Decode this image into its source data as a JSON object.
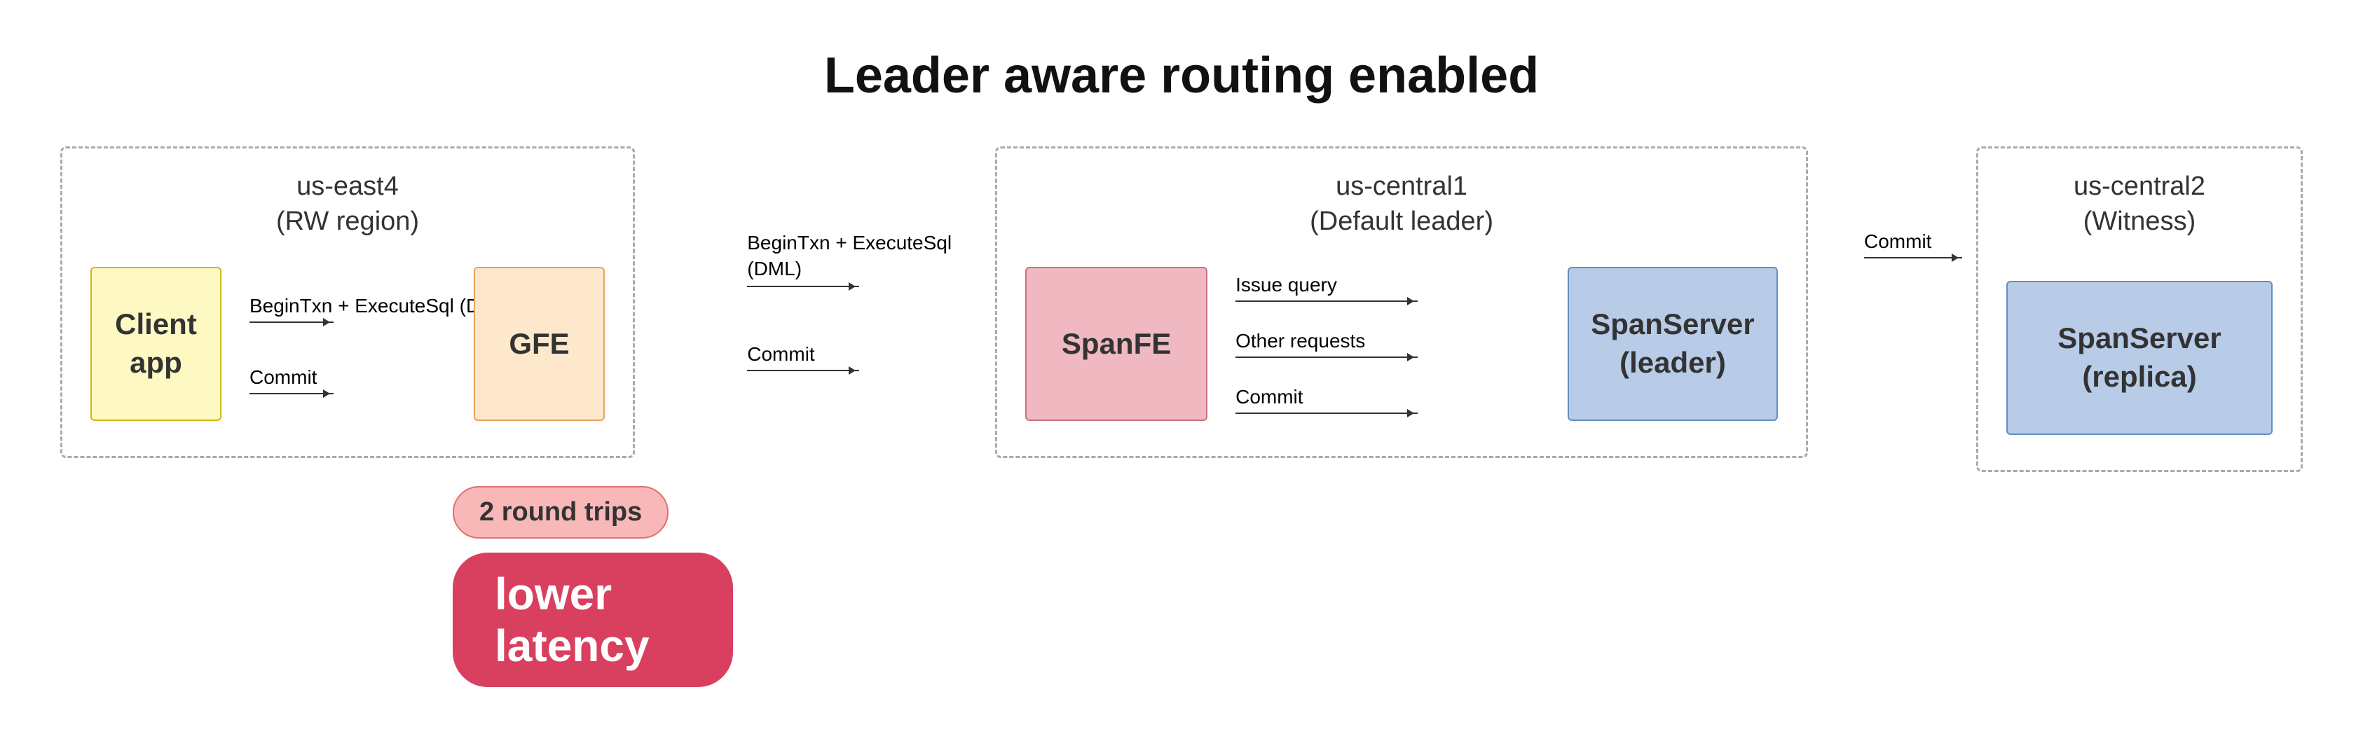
{
  "title": "Leader aware routing enabled",
  "regions": {
    "east": {
      "label_line1": "us-east4",
      "label_line2": "(RW region)"
    },
    "central": {
      "label_line1": "us-central1",
      "label_line2": "(Default leader)"
    },
    "central2": {
      "label_line1": "us-central2",
      "label_line2": "(Witness)"
    }
  },
  "boxes": {
    "client": "Client\napp",
    "gfe": "GFE",
    "spanfe": "SpanFE",
    "spanserver_leader": "SpanServer\n(leader)",
    "spanserver_replica": "SpanServer\n(replica)"
  },
  "arrows": {
    "client_to_gfe_top": "BeginTxn +\nExecuteSql (DML)",
    "client_to_gfe_bottom": "Commit",
    "gfe_to_spanfe_top": "BeginTxn +\nExecuteSql (DML)",
    "gfe_to_spanfe_bottom": "Commit",
    "spanfe_to_spanserver_top": "Issue query",
    "spanfe_to_spanserver_mid": "Other requests",
    "spanfe_to_spanserver_bottom": "Commit",
    "spanserver_to_replica": "Commit"
  },
  "badges": {
    "round_trips": "2 round trips",
    "latency": "lower latency"
  }
}
